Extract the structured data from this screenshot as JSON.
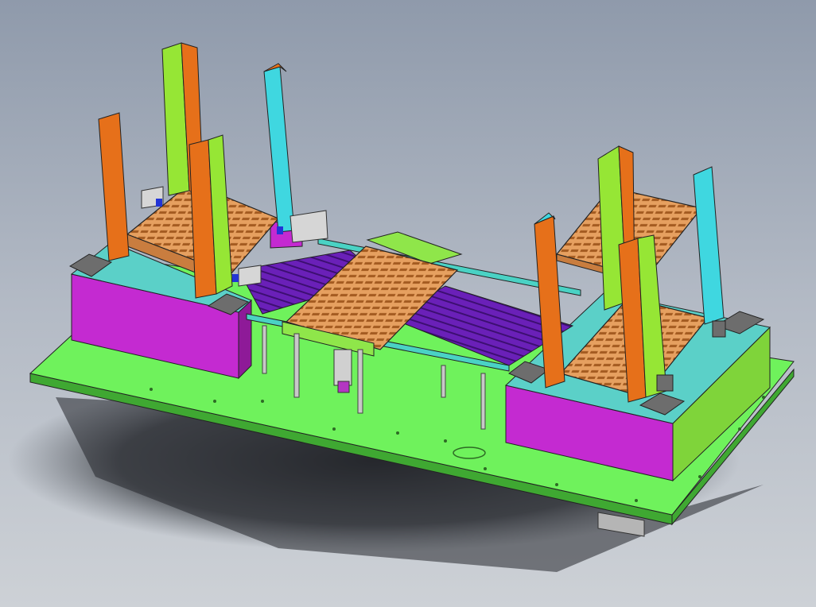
{
  "viewport": {
    "background_top": "#8f9aab",
    "background_mid": "#b3bac5",
    "background_bottom": "#cdd1d6"
  },
  "model": {
    "colors": {
      "base_plate": "#6ff25c",
      "base_plate_edge": "#3fa832",
      "magenta_block": "#c42ad1",
      "magenta_dark": "#8e1a98",
      "orange_post": "#e6701a",
      "lime_post": "#96e635",
      "cyan_post": "#3fd7e0",
      "tray_orange": "#e6a060",
      "tray_dark": "#a35a20",
      "purple_rail": "#6a20b8",
      "grey_part": "#6d6d6d",
      "shadow": "#2a2c30"
    }
  }
}
